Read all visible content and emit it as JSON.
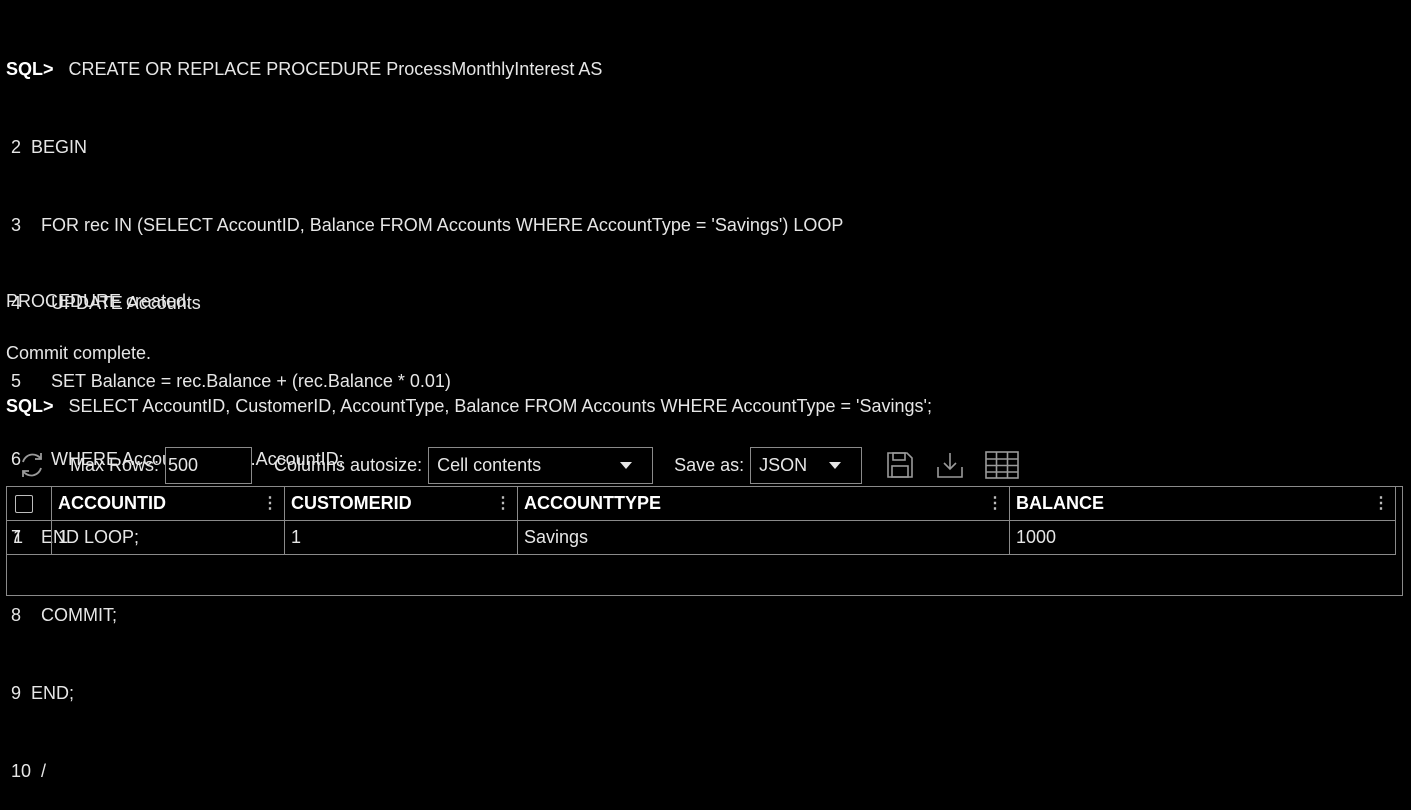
{
  "console": {
    "prompt": "SQL>",
    "first_statement": "CREATE OR REPLACE PROCEDURE ProcessMonthlyInterest AS",
    "continuation_lines": [
      {
        "num": " 2",
        "text": "  BEGIN"
      },
      {
        "num": " 3",
        "text": "    FOR rec IN (SELECT AccountID, Balance FROM Accounts WHERE AccountType = 'Savings') LOOP"
      },
      {
        "num": " 4",
        "text": "      UPDATE Accounts"
      },
      {
        "num": " 5",
        "text": "      SET Balance = rec.Balance + (rec.Balance * 0.01)"
      },
      {
        "num": " 6",
        "text": "      WHERE AccountID = rec.AccountID;"
      },
      {
        "num": " 7",
        "text": "    END LOOP;"
      },
      {
        "num": " 8",
        "text": "    COMMIT;"
      },
      {
        "num": " 9",
        "text": "  END;"
      },
      {
        "num": " 10",
        "text": "  /"
      }
    ],
    "output_1": "PROCEDURE created.",
    "output_2": "Commit complete.",
    "second_statement": "SELECT AccountID, CustomerID, AccountType, Balance FROM Accounts WHERE AccountType = 'Savings';"
  },
  "toolbar": {
    "max_rows_label": "Max Rows:",
    "max_rows_value": "500",
    "autosize_label": "Columns autosize:",
    "autosize_value": "Cell contents",
    "save_as_label": "Save as:",
    "save_as_value": "JSON",
    "icons": [
      "refresh-icon",
      "save-icon",
      "download-icon",
      "grid-icon"
    ]
  },
  "grid": {
    "columns": [
      "ACCOUNTID",
      "CUSTOMERID",
      "ACCOUNTTYPE",
      "BALANCE"
    ],
    "rows": [
      {
        "index": "1",
        "cells": [
          "1",
          "1",
          "Savings",
          "1000"
        ]
      }
    ]
  },
  "colors": {
    "background": "#000000",
    "text": "#e6e6e6",
    "border": "#8a8a8a"
  }
}
